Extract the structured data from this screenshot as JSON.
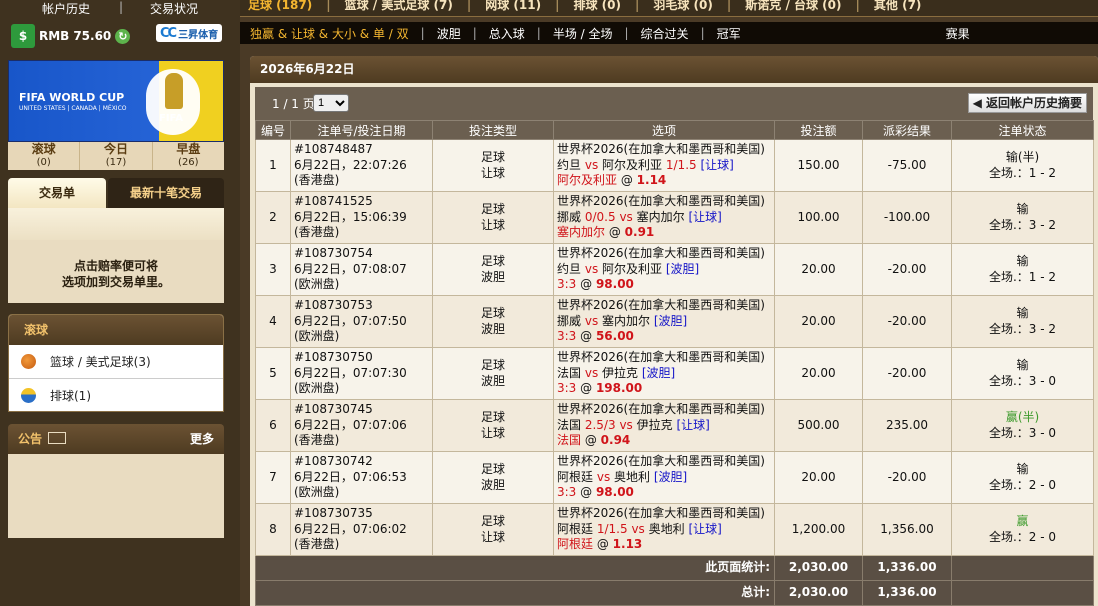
{
  "top_links": [
    "帐户历史",
    "|",
    "交易状况"
  ],
  "balance": {
    "currency": "RMB",
    "amount": "75.60"
  },
  "logo_text": "三昇体育",
  "banner": {
    "title": "FIFA WORLD CUP",
    "hosts": "UNITED STATES | CANADA | MÉXICO",
    "fifa": "FIFA"
  },
  "sport_tabs": [
    {
      "label": "滚球",
      "count": "(0)"
    },
    {
      "label": "今日",
      "count": "(17)"
    },
    {
      "label": "早盘",
      "count": "(26)"
    }
  ],
  "bet_tabs": {
    "active": "交易单",
    "other": "最新十笔交易"
  },
  "slip_text": [
    "点击赔率便可将",
    "选项加到交易单里。"
  ],
  "live": {
    "title": "滚球",
    "items": [
      {
        "label": "篮球 / 美式足球(3)",
        "icon": "basketball-icon"
      },
      {
        "label": "排球(1)",
        "icon": "volleyball-icon"
      }
    ]
  },
  "notice": {
    "title": "公告",
    "more": "更多"
  },
  "topnav": [
    "足球 (187)",
    "篮球 / 美式足球 (7)",
    "网球 (11)",
    "排球 (0)",
    "羽毛球 (0)",
    "斯诺克 / 台球 (0)",
    "其他 (7)"
  ],
  "subnav": [
    "独赢 & 让球 & 大小 & 单 / 双",
    "波胆",
    "总入球",
    "半场 / 全场",
    "综合过关",
    "冠军",
    "赛果"
  ],
  "date": "2026年6月22日",
  "pager": {
    "label": "1 / 1 页",
    "page": "1",
    "back": "返回帐户历史摘要"
  },
  "headers": [
    "编号",
    "注单号/投注日期",
    "投注类型",
    "选项",
    "投注额",
    "派彩结果",
    "注单状态"
  ],
  "rows": [
    {
      "no": "1",
      "id": "#108748487",
      "date": "6月22日，22:07:26",
      "market": "(香港盘)",
      "type1": "足球",
      "type2": "让球",
      "league": "世界杯2026(在加拿大和墨西哥和美国)",
      "home": "约旦",
      "hcap": "",
      "away": "阿尔及利亚",
      "line": "1/1.5",
      "tag": "[让球]",
      "pick": "阿尔及利亚",
      "odds": "1.14",
      "stake": "150.00",
      "result": "-75.00",
      "status": "输(半)",
      "win": false,
      "score": "全场.：1 - 2"
    },
    {
      "no": "2",
      "id": "#108741525",
      "date": "6月22日，15:06:39",
      "market": "(香港盘)",
      "type1": "足球",
      "type2": "让球",
      "league": "世界杯2026(在加拿大和墨西哥和美国)",
      "home": "挪威",
      "hcap": "0/0.5",
      "away": "塞内加尔",
      "line": "",
      "tag": "[让球]",
      "pick": "塞内加尔",
      "odds": "0.91",
      "stake": "100.00",
      "result": "-100.00",
      "status": "输",
      "win": false,
      "score": "全场.：3 - 2"
    },
    {
      "no": "3",
      "id": "#108730754",
      "date": "6月22日，07:08:07",
      "market": "(欧洲盘)",
      "type1": "足球",
      "type2": "波胆",
      "league": "世界杯2026(在加拿大和墨西哥和美国)",
      "home": "约旦",
      "hcap": "",
      "away": "阿尔及利亚",
      "line": "",
      "tag": "[波胆]",
      "pick": "3:3",
      "odds": "98.00",
      "stake": "20.00",
      "result": "-20.00",
      "status": "输",
      "win": false,
      "score": "全场.：1 - 2"
    },
    {
      "no": "4",
      "id": "#108730753",
      "date": "6月22日，07:07:50",
      "market": "(欧洲盘)",
      "type1": "足球",
      "type2": "波胆",
      "league": "世界杯2026(在加拿大和墨西哥和美国)",
      "home": "挪威",
      "hcap": "",
      "away": "塞内加尔",
      "line": "",
      "tag": "[波胆]",
      "pick": "3:3",
      "odds": "56.00",
      "stake": "20.00",
      "result": "-20.00",
      "status": "输",
      "win": false,
      "score": "全场.：3 - 2"
    },
    {
      "no": "5",
      "id": "#108730750",
      "date": "6月22日，07:07:30",
      "market": "(欧洲盘)",
      "type1": "足球",
      "type2": "波胆",
      "league": "世界杯2026(在加拿大和墨西哥和美国)",
      "home": "法国",
      "hcap": "",
      "away": "伊拉克",
      "line": "",
      "tag": "[波胆]",
      "pick": "3:3",
      "odds": "198.00",
      "stake": "20.00",
      "result": "-20.00",
      "status": "输",
      "win": false,
      "score": "全场.：3 - 0"
    },
    {
      "no": "6",
      "id": "#108730745",
      "date": "6月22日，07:07:06",
      "market": "(香港盘)",
      "type1": "足球",
      "type2": "让球",
      "league": "世界杯2026(在加拿大和墨西哥和美国)",
      "home": "法国",
      "hcap": "2.5/3",
      "away": "伊拉克",
      "line": "",
      "tag": "[让球]",
      "pick": "法国",
      "odds": "0.94",
      "stake": "500.00",
      "result": "235.00",
      "status": "赢(半)",
      "win": true,
      "score": "全场.：3 - 0"
    },
    {
      "no": "7",
      "id": "#108730742",
      "date": "6月22日，07:06:53",
      "market": "(欧洲盘)",
      "type1": "足球",
      "type2": "波胆",
      "league": "世界杯2026(在加拿大和墨西哥和美国)",
      "home": "阿根廷",
      "hcap": "",
      "away": "奥地利",
      "line": "",
      "tag": "[波胆]",
      "pick": "3:3",
      "odds": "98.00",
      "stake": "20.00",
      "result": "-20.00",
      "status": "输",
      "win": false,
      "score": "全场.：2 - 0"
    },
    {
      "no": "8",
      "id": "#108730735",
      "date": "6月22日，07:06:02",
      "market": "(香港盘)",
      "type1": "足球",
      "type2": "让球",
      "league": "世界杯2026(在加拿大和墨西哥和美国)",
      "home": "阿根廷",
      "hcap": "1/1.5",
      "away": "奥地利",
      "line": "",
      "tag": "[让球]",
      "pick": "阿根廷",
      "odds": "1.13",
      "stake": "1,200.00",
      "result": "1,356.00",
      "status": "赢",
      "win": true,
      "score": "全场.：2 - 0"
    }
  ],
  "totals": [
    {
      "label": "此页面统计:",
      "stake": "2,030.00",
      "result": "1,336.00"
    },
    {
      "label": "总计:",
      "stake": "2,030.00",
      "result": "1,336.00"
    }
  ]
}
